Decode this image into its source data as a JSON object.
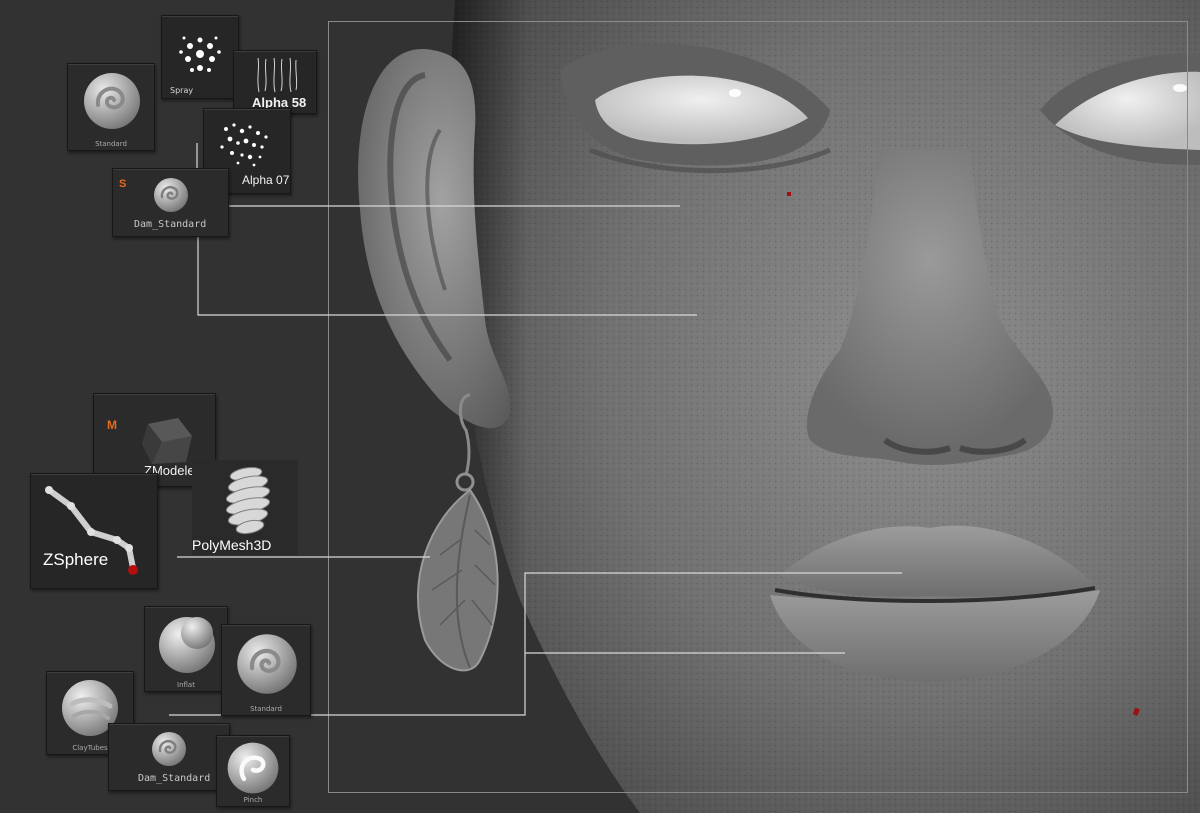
{
  "colors": {
    "background": "#323232",
    "tile": "#2b2b2b",
    "callout_line": "#d8d8d8",
    "frame": "#8a8a8a",
    "mark_orange": "#e46a1c",
    "zsphere_tip": "#b30f0f"
  },
  "brush_groups": {
    "eye_detail": {
      "standard": {
        "label": "Standard",
        "icon": "standard-brush-icon"
      },
      "spray": {
        "label": "Spray",
        "icon": "spray-stroke-icon"
      },
      "alpha58": {
        "label": "Alpha 58",
        "icon": "alpha-58-icon"
      },
      "alpha07": {
        "label": "Alpha 07",
        "icon": "alpha-07-icon"
      },
      "dam_standard": {
        "label": "Dam_Standard",
        "mark": "S",
        "icon": "dam-standard-brush-icon"
      }
    },
    "earring": {
      "zmodeler": {
        "label": "ZModeler",
        "mark": "M",
        "icon": "zmodeler-brush-icon"
      },
      "polymesh": {
        "label": "PolyMesh3D",
        "icon": "polymesh3d-spring-icon"
      },
      "zsphere": {
        "label": "ZSphere",
        "icon": "zsphere-chain-icon"
      }
    },
    "lips": {
      "inflat": {
        "label": "Inflat",
        "icon": "inflat-brush-icon"
      },
      "standard": {
        "label": "Standard",
        "icon": "standard-brush-icon"
      },
      "claytubes": {
        "label": "ClayTubes",
        "icon": "claytubes-brush-icon"
      },
      "dam_standard": {
        "label": "Dam_Standard",
        "icon": "dam-standard-brush-icon"
      },
      "pinch": {
        "label": "Pinch",
        "icon": "pinch-brush-icon"
      }
    }
  }
}
